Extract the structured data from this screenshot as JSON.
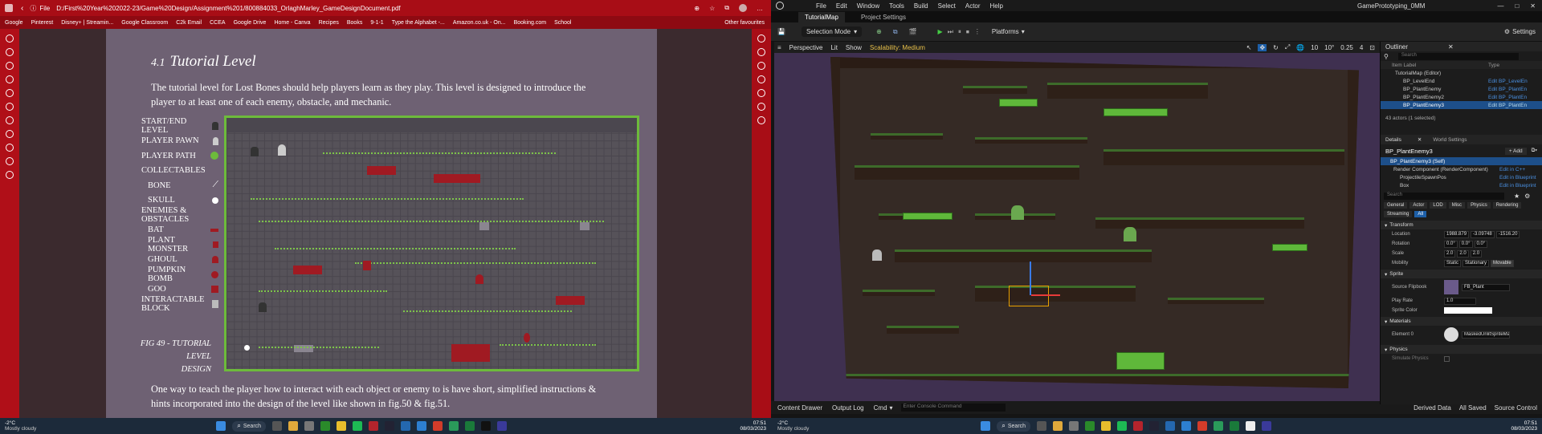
{
  "browser": {
    "tab_icon": "pdf-icon",
    "file_label": "File",
    "url": "D:/First%20Year%202022-23/Game%20Design/Assignment%201/800884033_OrlaghMarley_GameDesignDocument.pdf",
    "bookmarks": [
      "Google",
      "Pinterest",
      "Disney+ | Streamin...",
      "Google Classroom",
      "C2k Email",
      "CCEA",
      "Google Drive",
      "Home - Canva",
      "Recipes",
      "Books",
      "9-1-1",
      "Type the Alphabet -...",
      "Amazon.co.uk - On...",
      "Booking.com",
      "School",
      "Other favourites"
    ]
  },
  "pdf": {
    "heading_num": "4.1",
    "heading": "Tutorial Level",
    "intro": "The tutorial level for Lost Bones should help players learn as they play. This level is designed to introduce the player to at least one of each enemy, obstacle, and mechanic.",
    "legend": [
      "START/END LEVEL",
      "PLAYER PAWN",
      "PLAYER PATH",
      "COLLECTABLES",
      "BONE",
      "SKULL",
      "ENEMIES & OBSTACLES",
      "BAT",
      "PLANT MONSTER",
      "GHOUL",
      "PUMPKIN BOMB",
      "GOO",
      "INTERACTABLE BLOCK"
    ],
    "caption_line1": "FIG 49 - TUTORIAL LEVEL",
    "caption_line2": "DESIGN",
    "outro": "One way to teach the player how to interact with each object or enemy to is have short, simplified instructions & hints incorporated into the design of the level like shown in fig.50 & fig.51."
  },
  "taskbar_left": {
    "weather_temp": "-2°C",
    "weather_desc": "Mostly cloudy",
    "search": "Search",
    "time": "07:51",
    "date": "08/03/2023"
  },
  "taskbar_right": {
    "weather_temp": "-2°C",
    "weather_desc": "Mostly cloudy",
    "search": "Search",
    "time": "07:51",
    "date": "08/03/2023"
  },
  "unreal": {
    "menu": [
      "File",
      "Edit",
      "Window",
      "Tools",
      "Build",
      "Select",
      "Actor",
      "Help"
    ],
    "project": "GamePrototyping_0MM",
    "tabs": [
      "TutorialMap",
      "Project Settings"
    ],
    "mode": "Selection Mode",
    "platforms": "Platforms",
    "settings": "Settings",
    "viewport_bar": [
      "Perspective",
      "Lit",
      "Show"
    ],
    "scalability": "Scalability: Medium",
    "snap_values": [
      "10",
      "10°",
      "0.25",
      "4"
    ],
    "bottom": [
      "Content Drawer",
      "Output Log",
      "Cmd"
    ],
    "console_placeholder": "Enter Console Command",
    "bottom_right": [
      "Derived Data",
      "All Saved",
      "Source Control"
    ],
    "outliner": {
      "title": "Outliner",
      "search": "Search",
      "col_label": "Item Label",
      "col_type": "Type",
      "rows": [
        {
          "label": "TutorialMap (Editor)",
          "type": ""
        },
        {
          "label": "BP_LevelEnd",
          "type": "Edit BP_LevelEn"
        },
        {
          "label": "BP_PlantEnemy",
          "type": "Edit BP_PlantEn"
        },
        {
          "label": "BP_PlantEnemy2",
          "type": "Edit BP_PlantEn"
        },
        {
          "label": "BP_PlantEnemy3",
          "type": "Edit BP_PlantEn"
        }
      ],
      "count": "43 actors (1 selected)"
    },
    "details": {
      "title": "Details",
      "world_settings": "World Settings",
      "actor": "BP_PlantEnemy3",
      "add": "+ Add",
      "self": "BP_PlantEnemy3 (Self)",
      "components": [
        {
          "label": "Render Component (RenderComponent)",
          "link": "Edit in C++"
        },
        {
          "label": "ProjectileSpawnPos",
          "link": "Edit in Blueprint"
        },
        {
          "label": "Box",
          "link": "Edit in Blueprint"
        }
      ],
      "search": "Search",
      "filter_tabs": [
        "General",
        "Actor",
        "LOD",
        "Misc",
        "Physics",
        "Rendering",
        "Streaming",
        "All"
      ],
      "transform": "Transform",
      "location": {
        "label": "Location",
        "x": "1988.879",
        "y": "-3.09748",
        "z": "-1516.20"
      },
      "rotation": {
        "label": "Rotation",
        "x": "0.0°",
        "y": "0.0°",
        "z": "0.0°"
      },
      "scale": {
        "label": "Scale",
        "x": "2.0",
        "y": "2.0",
        "z": "2.0"
      },
      "mobility": {
        "label": "Mobility",
        "options": [
          "Static",
          "Stationary",
          "Movable"
        ]
      },
      "sprite": "Sprite",
      "source_flipbook": {
        "label": "Source Flipbook",
        "value": "FB_Plant"
      },
      "play_rate": {
        "label": "Play Rate",
        "value": "1.0"
      },
      "sprite_color": "Sprite Color",
      "materials": "Materials",
      "element0": {
        "label": "Element 0",
        "value": "MaskedUnlitSpriteMateri"
      },
      "physics": "Physics",
      "simulate": "Simulate Physics"
    }
  }
}
